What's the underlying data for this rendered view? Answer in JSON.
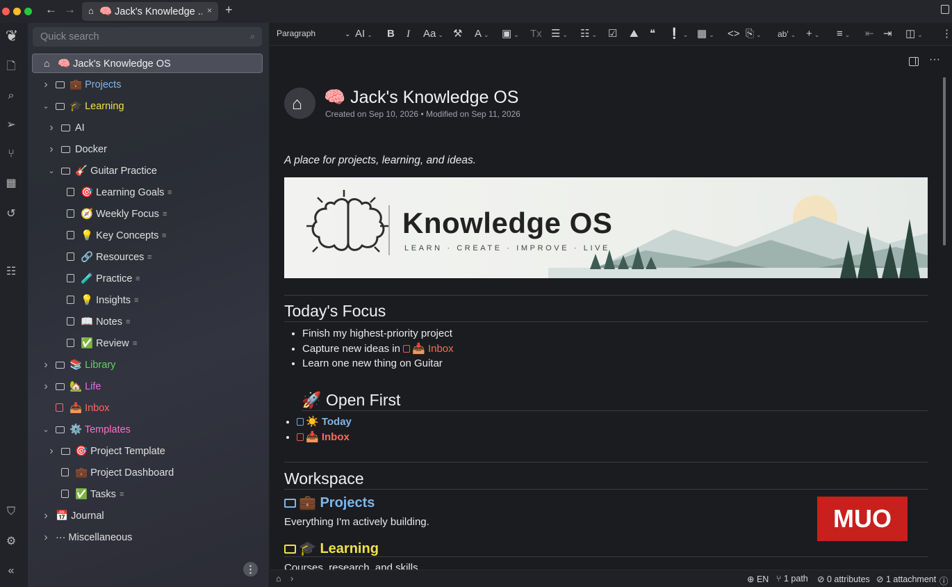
{
  "titlebar": {
    "tab_title": "🧠 Jack's Knowledge ...",
    "tab_close": "×",
    "back": "←",
    "forward": "→",
    "new_tab": "+"
  },
  "sidebar": {
    "search_placeholder": "Quick search",
    "tree": [
      {
        "id": "root",
        "label": "🧠 Jack's Knowledge OS",
        "kind": "home",
        "depth": 0,
        "color": "#f0f0f0",
        "active": true
      },
      {
        "id": "projects",
        "label": "💼 Projects",
        "kind": "folder",
        "depth": 1,
        "color": "#7fb6ea",
        "expand": "right"
      },
      {
        "id": "learning",
        "label": "🎓 Learning",
        "kind": "folder",
        "depth": 1,
        "color": "#f0e14a",
        "expand": "down"
      },
      {
        "id": "ai",
        "label": "AI",
        "kind": "folder",
        "depth": 2,
        "color": "#e0e0e0",
        "expand": "right"
      },
      {
        "id": "docker",
        "label": "Docker",
        "kind": "folder",
        "depth": 2,
        "color": "#e0e0e0",
        "expand": "right"
      },
      {
        "id": "guitar",
        "label": "🎸 Guitar Practice",
        "kind": "folder",
        "depth": 2,
        "color": "#e0e0e0",
        "expand": "down"
      },
      {
        "id": "goals",
        "label": "🎯 Learning Goals",
        "kind": "note",
        "depth": 3,
        "color": "#e0e0e0",
        "ptr": true
      },
      {
        "id": "weekly",
        "label": "🧭 Weekly Focus",
        "kind": "note",
        "depth": 3,
        "color": "#e0e0e0",
        "ptr": true
      },
      {
        "id": "concepts",
        "label": "💡 Key Concepts",
        "kind": "note",
        "depth": 3,
        "color": "#e0e0e0",
        "ptr": true
      },
      {
        "id": "resources",
        "label": "🔗 Resources",
        "kind": "note",
        "depth": 3,
        "color": "#e0e0e0",
        "ptr": true
      },
      {
        "id": "practice",
        "label": "🧪 Practice",
        "kind": "note",
        "depth": 3,
        "color": "#e0e0e0",
        "ptr": true
      },
      {
        "id": "insights",
        "label": "💡 Insights",
        "kind": "note",
        "depth": 3,
        "color": "#e0e0e0",
        "ptr": true
      },
      {
        "id": "notes",
        "label": "📖 Notes",
        "kind": "note",
        "depth": 3,
        "color": "#e0e0e0",
        "ptr": true
      },
      {
        "id": "review",
        "label": "✅ Review",
        "kind": "note",
        "depth": 3,
        "color": "#e0e0e0",
        "ptr": true
      },
      {
        "id": "library",
        "label": "📚 Library",
        "kind": "folder",
        "depth": 1,
        "color": "#5fd35f",
        "expand": "right"
      },
      {
        "id": "life",
        "label": "🏡 Life",
        "kind": "folder",
        "depth": 1,
        "color": "#e06fe0",
        "expand": "right"
      },
      {
        "id": "inbox",
        "label": "📥 Inbox",
        "kind": "note-red",
        "depth": 1,
        "color": "#ff6a5c"
      },
      {
        "id": "templates",
        "label": "⚙️ Templates",
        "kind": "folder",
        "depth": 1,
        "color": "#ff6fc8",
        "expand": "down"
      },
      {
        "id": "proj-template",
        "label": "🎯 Project Template",
        "kind": "folder",
        "depth": 2,
        "color": "#e0e0e0",
        "expand": "right"
      },
      {
        "id": "proj-dashboard",
        "label": "💼 Project Dashboard",
        "kind": "note",
        "depth": 2,
        "color": "#e0e0e0"
      },
      {
        "id": "tasks",
        "label": "✅ Tasks",
        "kind": "note",
        "depth": 2,
        "color": "#e0e0e0",
        "ptr": true
      },
      {
        "id": "journal",
        "label": "📅 Journal",
        "kind": "plain",
        "depth": 1,
        "color": "#e0e0e0",
        "expand": "right"
      },
      {
        "id": "misc",
        "label": "··· Miscellaneous",
        "kind": "plain",
        "depth": 1,
        "color": "#e0e0e0",
        "expand": "right"
      }
    ]
  },
  "toolbar": {
    "block_type": "Paragraph"
  },
  "note": {
    "title": "🧠 Jack's Knowledge OS",
    "meta": "Created on Sep 10, 2026 • Modified on Sep 11, 2026",
    "tagline": "A place for projects, learning, and ideas.",
    "banner": {
      "brand": "Knowledge OS",
      "motto": "LEARN · CREATE · IMPROVE · LIVE"
    },
    "focus": {
      "heading": "Today's Focus",
      "item1": "Finish my highest-priority project",
      "item2_prefix": "Capture new ideas in ",
      "item2_link": "📥 Inbox",
      "item3": "Learn one new thing on Guitar"
    },
    "open_first": {
      "heading": "🚀 Open First",
      "link1": "☀️ Today",
      "link2": "📥 Inbox"
    },
    "workspace": {
      "heading": "Workspace",
      "projects_link": "💼 Projects",
      "projects_desc": "Everything I'm actively building.",
      "learning_link": "🎓 Learning",
      "learning_desc": "Courses, research, and skills."
    }
  },
  "watermark": "MUO",
  "statusbar": {
    "lang": "EN",
    "paths": "1 path",
    "attributes": "0 attributes",
    "attachments": "1 attachment"
  }
}
